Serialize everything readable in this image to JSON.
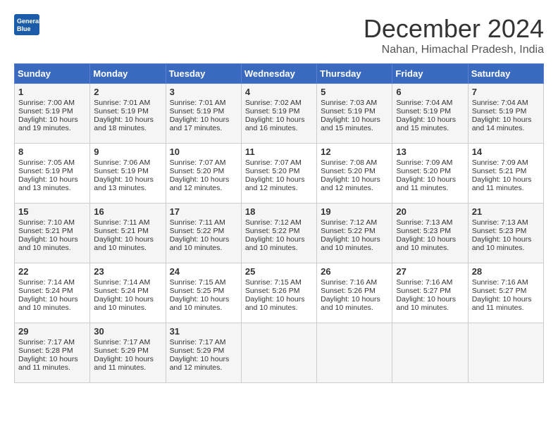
{
  "header": {
    "logo_line1": "General",
    "logo_line2": "Blue",
    "month": "December 2024",
    "location": "Nahan, Himachal Pradesh, India"
  },
  "days_of_week": [
    "Sunday",
    "Monday",
    "Tuesday",
    "Wednesday",
    "Thursday",
    "Friday",
    "Saturday"
  ],
  "weeks": [
    [
      {
        "day": 1,
        "sunrise": "7:00 AM",
        "sunset": "5:19 PM",
        "daylight": "10 hours and 19 minutes."
      },
      {
        "day": 2,
        "sunrise": "7:01 AM",
        "sunset": "5:19 PM",
        "daylight": "10 hours and 18 minutes."
      },
      {
        "day": 3,
        "sunrise": "7:01 AM",
        "sunset": "5:19 PM",
        "daylight": "10 hours and 17 minutes."
      },
      {
        "day": 4,
        "sunrise": "7:02 AM",
        "sunset": "5:19 PM",
        "daylight": "10 hours and 16 minutes."
      },
      {
        "day": 5,
        "sunrise": "7:03 AM",
        "sunset": "5:19 PM",
        "daylight": "10 hours and 15 minutes."
      },
      {
        "day": 6,
        "sunrise": "7:04 AM",
        "sunset": "5:19 PM",
        "daylight": "10 hours and 15 minutes."
      },
      {
        "day": 7,
        "sunrise": "7:04 AM",
        "sunset": "5:19 PM",
        "daylight": "10 hours and 14 minutes."
      }
    ],
    [
      {
        "day": 8,
        "sunrise": "7:05 AM",
        "sunset": "5:19 PM",
        "daylight": "10 hours and 13 minutes."
      },
      {
        "day": 9,
        "sunrise": "7:06 AM",
        "sunset": "5:19 PM",
        "daylight": "10 hours and 13 minutes."
      },
      {
        "day": 10,
        "sunrise": "7:07 AM",
        "sunset": "5:20 PM",
        "daylight": "10 hours and 12 minutes."
      },
      {
        "day": 11,
        "sunrise": "7:07 AM",
        "sunset": "5:20 PM",
        "daylight": "10 hours and 12 minutes."
      },
      {
        "day": 12,
        "sunrise": "7:08 AM",
        "sunset": "5:20 PM",
        "daylight": "10 hours and 12 minutes."
      },
      {
        "day": 13,
        "sunrise": "7:09 AM",
        "sunset": "5:20 PM",
        "daylight": "10 hours and 11 minutes."
      },
      {
        "day": 14,
        "sunrise": "7:09 AM",
        "sunset": "5:21 PM",
        "daylight": "10 hours and 11 minutes."
      }
    ],
    [
      {
        "day": 15,
        "sunrise": "7:10 AM",
        "sunset": "5:21 PM",
        "daylight": "10 hours and 10 minutes."
      },
      {
        "day": 16,
        "sunrise": "7:11 AM",
        "sunset": "5:21 PM",
        "daylight": "10 hours and 10 minutes."
      },
      {
        "day": 17,
        "sunrise": "7:11 AM",
        "sunset": "5:22 PM",
        "daylight": "10 hours and 10 minutes."
      },
      {
        "day": 18,
        "sunrise": "7:12 AM",
        "sunset": "5:22 PM",
        "daylight": "10 hours and 10 minutes."
      },
      {
        "day": 19,
        "sunrise": "7:12 AM",
        "sunset": "5:22 PM",
        "daylight": "10 hours and 10 minutes."
      },
      {
        "day": 20,
        "sunrise": "7:13 AM",
        "sunset": "5:23 PM",
        "daylight": "10 hours and 10 minutes."
      },
      {
        "day": 21,
        "sunrise": "7:13 AM",
        "sunset": "5:23 PM",
        "daylight": "10 hours and 10 minutes."
      }
    ],
    [
      {
        "day": 22,
        "sunrise": "7:14 AM",
        "sunset": "5:24 PM",
        "daylight": "10 hours and 10 minutes."
      },
      {
        "day": 23,
        "sunrise": "7:14 AM",
        "sunset": "5:24 PM",
        "daylight": "10 hours and 10 minutes."
      },
      {
        "day": 24,
        "sunrise": "7:15 AM",
        "sunset": "5:25 PM",
        "daylight": "10 hours and 10 minutes."
      },
      {
        "day": 25,
        "sunrise": "7:15 AM",
        "sunset": "5:26 PM",
        "daylight": "10 hours and 10 minutes."
      },
      {
        "day": 26,
        "sunrise": "7:16 AM",
        "sunset": "5:26 PM",
        "daylight": "10 hours and 10 minutes."
      },
      {
        "day": 27,
        "sunrise": "7:16 AM",
        "sunset": "5:27 PM",
        "daylight": "10 hours and 10 minutes."
      },
      {
        "day": 28,
        "sunrise": "7:16 AM",
        "sunset": "5:27 PM",
        "daylight": "10 hours and 11 minutes."
      }
    ],
    [
      {
        "day": 29,
        "sunrise": "7:17 AM",
        "sunset": "5:28 PM",
        "daylight": "10 hours and 11 minutes."
      },
      {
        "day": 30,
        "sunrise": "7:17 AM",
        "sunset": "5:29 PM",
        "daylight": "10 hours and 11 minutes."
      },
      {
        "day": 31,
        "sunrise": "7:17 AM",
        "sunset": "5:29 PM",
        "daylight": "10 hours and 12 minutes."
      },
      null,
      null,
      null,
      null
    ]
  ]
}
